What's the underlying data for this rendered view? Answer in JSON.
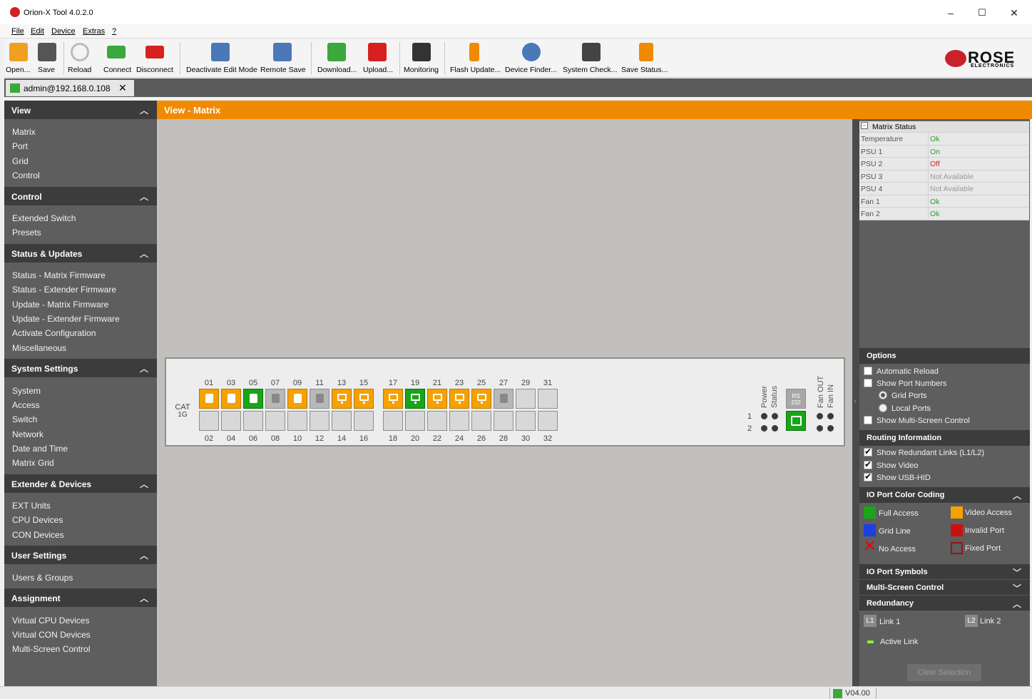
{
  "window": {
    "title": "Orion-X Tool 4.0.2.0",
    "minimize": "–",
    "maximize": "☐",
    "close": "✕"
  },
  "menu": [
    "File",
    "Edit",
    "Device",
    "Extras",
    "?"
  ],
  "toolbar": {
    "buttons": [
      {
        "label": "Open...",
        "icon": "folder-icon",
        "color": "#f0a020"
      },
      {
        "label": "Save",
        "icon": "floppy-disk-icon",
        "color": "#555555"
      },
      {
        "label": "Reload",
        "icon": "reload-icon",
        "color": "#bbbbbb"
      },
      {
        "label": "Connect",
        "icon": "connect-icon",
        "color": "#3aa83a"
      },
      {
        "label": "Disconnect",
        "icon": "disconnect-icon",
        "color": "#d82020"
      },
      {
        "label": "Deactivate Edit Mode",
        "icon": "edit-mode-icon",
        "color": "#4a78b8"
      },
      {
        "label": "Remote Save",
        "icon": "remote-save-icon",
        "color": "#4a78b8"
      },
      {
        "label": "Download...",
        "icon": "download-icon",
        "color": "#3aa83a"
      },
      {
        "label": "Upload...",
        "icon": "upload-icon",
        "color": "#d82020"
      },
      {
        "label": "Monitoring",
        "icon": "monitoring-icon",
        "color": "#333333"
      },
      {
        "label": "Flash Update...",
        "icon": "flash-update-icon",
        "color": "#f08a00"
      },
      {
        "label": "Device Finder...",
        "icon": "device-finder-icon",
        "color": "#4a78b8"
      },
      {
        "label": "System Check...",
        "icon": "system-check-icon",
        "color": "#444444"
      },
      {
        "label": "Save Status...",
        "icon": "save-status-icon",
        "color": "#f08a00"
      }
    ],
    "logo": {
      "text": "ROSE",
      "sub": "ELECTRONICS"
    }
  },
  "session": {
    "label": "admin@192.168.0.108",
    "close": "✕"
  },
  "sidebar": {
    "sections": [
      {
        "title": "View",
        "items": [
          "Matrix",
          "Port",
          "Grid",
          "Control"
        ]
      },
      {
        "title": "Control",
        "items": [
          "Extended Switch",
          "Presets"
        ]
      },
      {
        "title": "Status & Updates",
        "items": [
          "Status - Matrix Firmware",
          "Status - Extender Firmware",
          "Update - Matrix Firmware",
          "Update - Extender Firmware",
          "Activate Configuration",
          "Miscellaneous"
        ]
      },
      {
        "title": "System Settings",
        "items": [
          "System",
          "Access",
          "Switch",
          "Network",
          "Date and Time",
          "Matrix Grid"
        ]
      },
      {
        "title": "Extender & Devices",
        "items": [
          "EXT Units",
          "CPU Devices",
          "CON Devices"
        ]
      },
      {
        "title": "User Settings",
        "items": [
          "Users & Groups"
        ]
      },
      {
        "title": "Assignment",
        "items": [
          "Virtual CPU Devices",
          "Virtual CON Devices",
          "Multi-Screen Control"
        ]
      }
    ]
  },
  "view": {
    "title": "View - Matrix",
    "matrix": {
      "label_cat": "CAT",
      "label_1g": "1G",
      "top_numbers": [
        "01",
        "03",
        "05",
        "07",
        "09",
        "11",
        "13",
        "15",
        "17",
        "19",
        "21",
        "23",
        "25",
        "27",
        "29",
        "31"
      ],
      "bottom_numbers": [
        "02",
        "04",
        "06",
        "08",
        "10",
        "12",
        "14",
        "16",
        "18",
        "20",
        "22",
        "24",
        "26",
        "28",
        "30",
        "32"
      ],
      "top_ports": [
        "orange-cpu",
        "orange-cpu",
        "green-cpu",
        "grey-cpu",
        "orange-cpu",
        "grey-cpu",
        "orange-con",
        "orange-con",
        "orange-con",
        "green-con",
        "orange-con",
        "orange-con",
        "orange-con",
        "grey-cpu",
        "empty",
        "empty"
      ],
      "bottom_ports": [
        "empty",
        "empty",
        "empty",
        "empty",
        "empty",
        "empty",
        "empty",
        "empty",
        "empty",
        "empty",
        "empty",
        "empty",
        "empty",
        "empty",
        "empty",
        "empty"
      ],
      "power_label": "Power",
      "status_label": "Status",
      "rs232_label": "RS 232",
      "fan_out_label": "Fan OUT",
      "fan_in_label": "Fan IN",
      "row1": "1",
      "row2": "2"
    }
  },
  "right_panel": {
    "status_title": "Matrix Status",
    "status_toggle": "–",
    "status_rows": [
      {
        "key": "Temperature",
        "value": "Ok",
        "color": "#2aa02a"
      },
      {
        "key": "PSU 1",
        "value": "On",
        "color": "#2aa02a"
      },
      {
        "key": "PSU 2",
        "value": "Off",
        "color": "#d82020"
      },
      {
        "key": "PSU 3",
        "value": "Not Available",
        "color": "#999999"
      },
      {
        "key": "PSU 4",
        "value": "Not Available",
        "color": "#999999"
      },
      {
        "key": "Fan 1",
        "value": "Ok",
        "color": "#2aa02a"
      },
      {
        "key": "Fan 2",
        "value": "Ok",
        "color": "#2aa02a"
      }
    ],
    "options": {
      "title": "Options",
      "automatic_reload": "Automatic Reload",
      "show_port_numbers": "Show Port Numbers",
      "grid_ports": "Grid Ports",
      "local_ports": "Local Ports",
      "show_multi_screen": "Show Multi-Screen Control"
    },
    "routing": {
      "title": "Routing Information",
      "redundant": "Show Redundant Links (L1/L2)",
      "video": "Show Video",
      "usb": "Show USB-HID"
    },
    "color_coding": {
      "title": "IO Port Color Coding",
      "full_access": "Full Access",
      "video_access": "Video Access",
      "grid_line": "Grid Line",
      "invalid_port": "Invalid Port",
      "no_access": "No Access",
      "fixed_port": "Fixed Port"
    },
    "io_symbols": "IO Port Symbols",
    "multi_screen": "Multi-Screen Control",
    "redundancy": {
      "title": "Redundancy",
      "l1_badge": "L1",
      "l1": "Link 1",
      "l2_badge": "L2",
      "l2": "Link 2",
      "active": "Active Link"
    },
    "clear_selection": "Clear Selection"
  },
  "statusbar": {
    "version": "V04.00"
  }
}
